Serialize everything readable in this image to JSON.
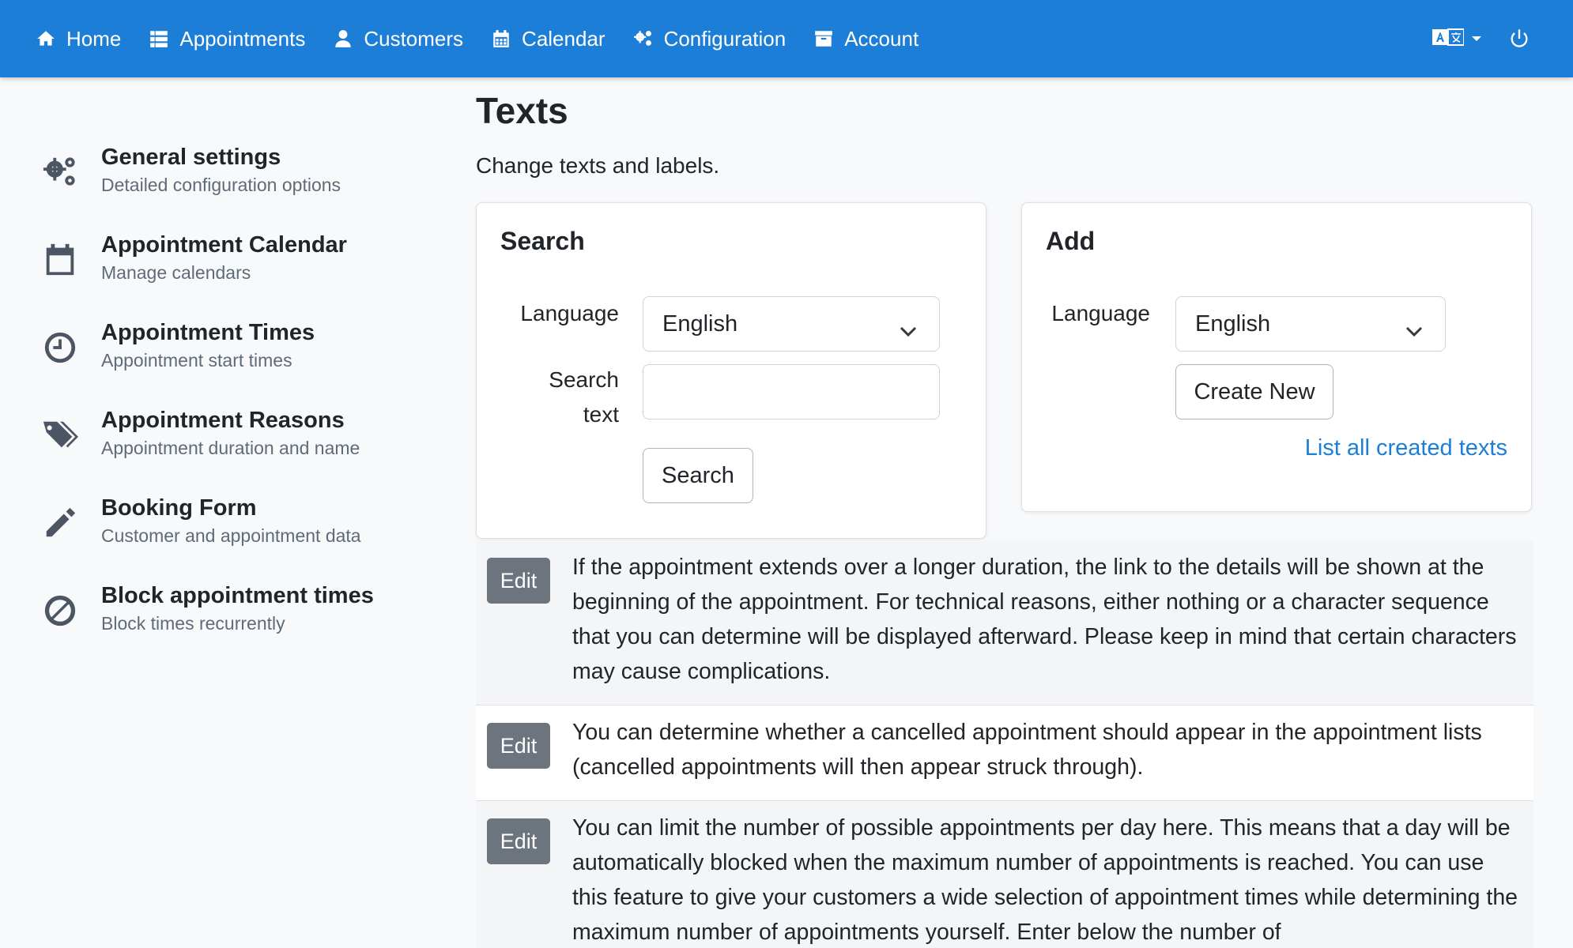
{
  "nav": {
    "items": [
      {
        "label": "Home",
        "icon": "home-icon"
      },
      {
        "label": "Appointments",
        "icon": "list-icon"
      },
      {
        "label": "Customers",
        "icon": "user-icon"
      },
      {
        "label": "Calendar",
        "icon": "calendar-icon"
      },
      {
        "label": "Configuration",
        "icon": "gears-icon"
      },
      {
        "label": "Account",
        "icon": "archive-icon"
      }
    ],
    "language_icon": "language-icon",
    "power_icon": "power-icon"
  },
  "sidebar": {
    "items": [
      {
        "title": "General settings",
        "desc": "Detailed configuration options",
        "icon": "gears-icon"
      },
      {
        "title": "Appointment Calendar",
        "desc": "Manage calendars",
        "icon": "calendar-icon"
      },
      {
        "title": "Appointment Times",
        "desc": "Appointment start times",
        "icon": "clock-icon"
      },
      {
        "title": "Appointment Reasons",
        "desc": "Appointment duration and name",
        "icon": "tags-icon"
      },
      {
        "title": "Booking Form",
        "desc": "Customer and appointment data",
        "icon": "pencil-icon"
      },
      {
        "title": "Block appointment times",
        "desc": "Block times recurrently",
        "icon": "ban-icon"
      }
    ]
  },
  "page": {
    "title": "Texts",
    "subtitle": "Change texts and labels."
  },
  "search_card": {
    "title": "Search",
    "language_label": "Language",
    "language_value": "English",
    "search_label_line1": "Search",
    "search_label_line2": "text",
    "search_value": "",
    "search_button": "Search"
  },
  "add_card": {
    "title": "Add",
    "language_label": "Language",
    "language_value": "English",
    "create_button": "Create New",
    "list_link": "List all created texts"
  },
  "texts": {
    "edit_label": "Edit",
    "rows": [
      "If the appointment extends over a longer duration, the link to the details will be shown at the beginning of the appointment. For technical reasons, either nothing or a character sequence that you can determine will be displayed afterward. Please keep in mind that certain characters may cause complications.",
      "You can determine whether a cancelled appointment should appear in the appointment lists (cancelled appointments will then appear struck through).",
      "You can limit the number of possible appointments per day here. This means that a day will be automatically blocked when the maximum number of appointments is reached. You can use this feature to give your customers a wide selection of appointment times while determining the maximum number of appointments yourself. Enter below the number of"
    ]
  },
  "colors": {
    "navbar": "#1c7ed6",
    "link": "#1c7ed6",
    "edit_button": "#6c757d",
    "sidebar_icon": "#4b5563"
  }
}
